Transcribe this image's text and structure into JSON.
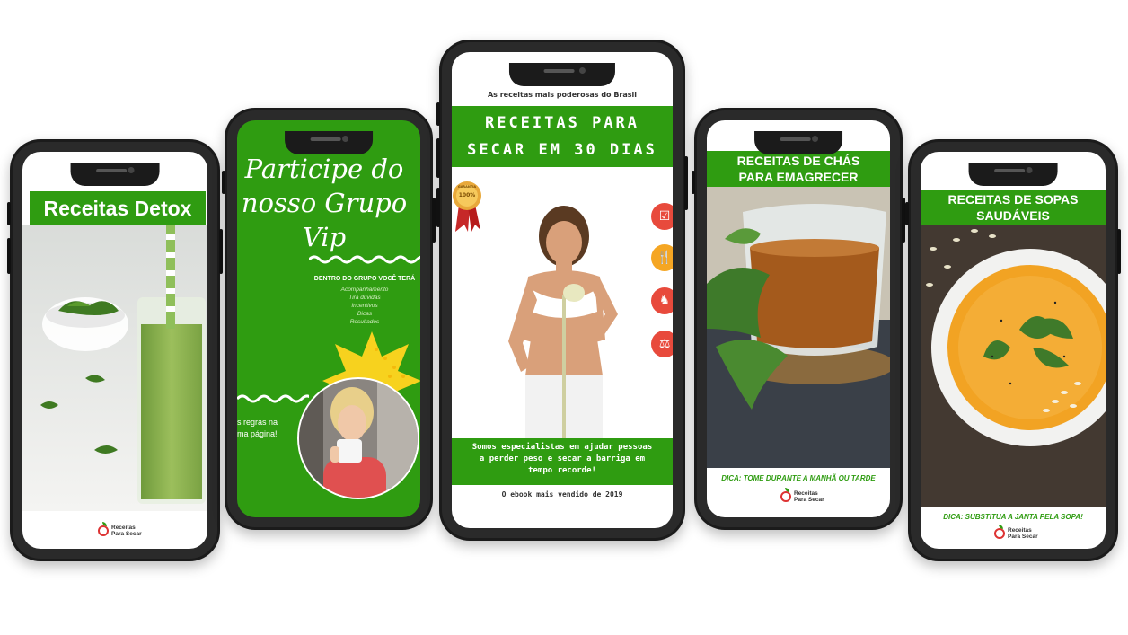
{
  "phones": {
    "detox": {
      "title": "Receitas Detox",
      "logo_line1": "Receitas",
      "logo_line2": "Para Secar"
    },
    "grupo": {
      "title_line1": "Participe do",
      "title_line2": "nosso Grupo Vip",
      "subtitle": "DENTRO DO GRUPO VOCÊ TERÁ",
      "items": [
        "Acompanhamento",
        "Tira dúvidas",
        "Incentivos",
        "Dicas",
        "Resultados"
      ],
      "rules_line1": "s regras na",
      "rules_line2": "ma página!"
    },
    "main": {
      "tagline": "As receitas mais poderosas do Brasil",
      "title_line1": "RECEITAS PARA",
      "title_line2": "SECAR EM 30 DIAS",
      "seal_text": "100%",
      "seal_ribbon": "GARANTIA",
      "bottom_text_line1": "Somos especialistas em ajudar pessoas",
      "bottom_text_line2": "a perder peso e secar a barriga em",
      "bottom_text_line3": "tempo recorde!",
      "footer": "O ebook mais vendido de 2019",
      "icon_colors": [
        "#e84a3c",
        "#f5a623",
        "#e84a3c",
        "#e84a3c"
      ]
    },
    "chas": {
      "title_line1": "RECEITAS DE CHÁS",
      "title_line2": "PARA EMAGRECER",
      "dica": "DICA: TOME DURANTE A MANHÃ OU TARDE",
      "logo_line1": "Receitas",
      "logo_line2": "Para Secar"
    },
    "sopas": {
      "title_line1": "RECEITAS DE SOPAS",
      "title_line2": "SAUDÁVEIS",
      "dica": "DICA: SUBSTITUA A JANTA PELA SOPA!",
      "logo_line1": "Receitas",
      "logo_line2": "Para Secar"
    }
  },
  "colors": {
    "brand_green": "#2f9c11",
    "phone_body": "#1b1b1b",
    "accent_red": "#d33333"
  }
}
